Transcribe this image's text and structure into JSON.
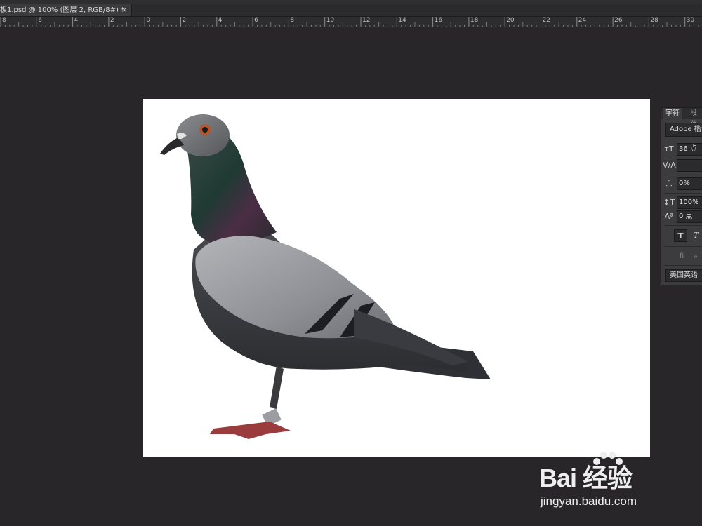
{
  "document_tab": {
    "title": "板1.psd @ 100% (图层 2, RGB/8#) *",
    "close_glyph": "×"
  },
  "ruler": {
    "labels": [
      "8",
      "6",
      "4",
      "2",
      "0",
      "2",
      "4",
      "6",
      "8",
      "10",
      "12",
      "14",
      "16",
      "18",
      "20",
      "22",
      "24",
      "26",
      "28",
      "30"
    ]
  },
  "character_panel": {
    "tab_character": "字符",
    "tab_paragraph": "段落",
    "font_family": "Adobe 楷体",
    "font_size": "36 点",
    "kerning": "",
    "tracking": "0%",
    "vertical_scale": "100%",
    "baseline_shift": "0 点",
    "bold_label": "T",
    "italic_label": "T",
    "language": "美国英语"
  },
  "icons": {
    "size": "font-size-icon",
    "kerning": "kerning-icon",
    "tracking": "tracking-icon",
    "vscale": "vertical-scale-icon",
    "baseline": "baseline-shift-icon",
    "ligature": "ligature-icon",
    "swash": "swash-icon"
  },
  "watermark": {
    "brand": "Bai 经验",
    "url": "jingyan.baidu.com"
  },
  "colors": {
    "workspace": "#282629",
    "panel": "#3c3b3d",
    "document": "#ffffff"
  }
}
